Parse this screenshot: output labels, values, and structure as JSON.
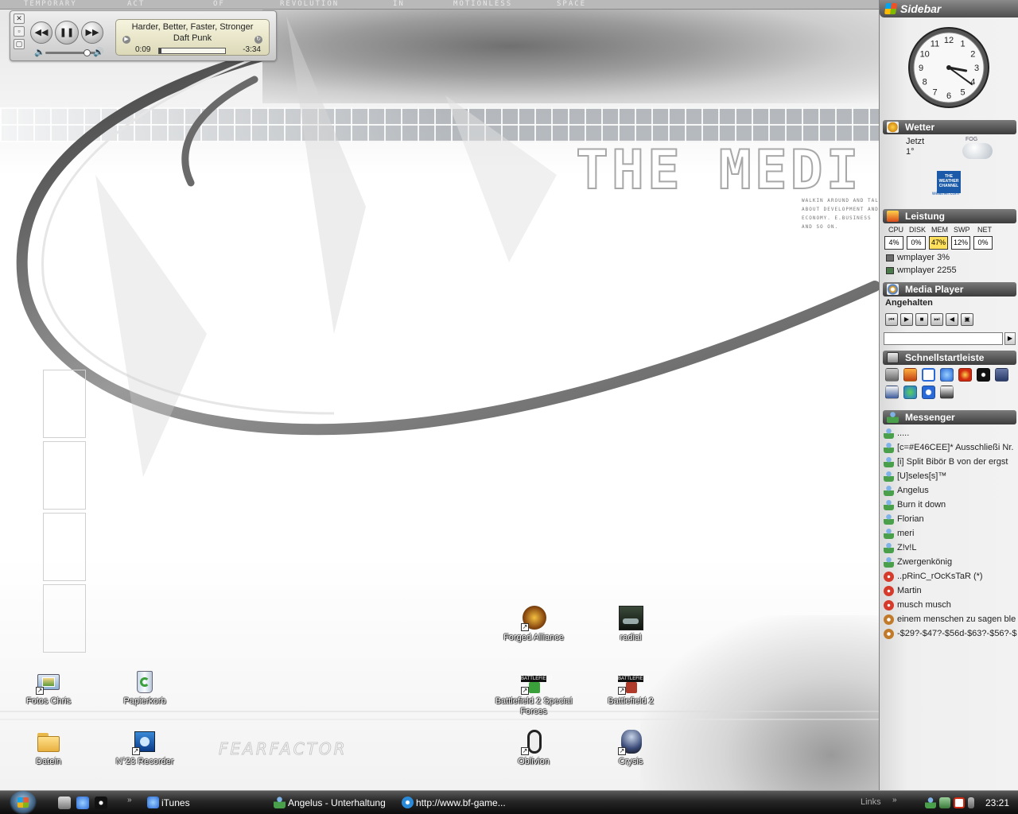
{
  "wallpaper": {
    "top_words": [
      "TEMPORARY",
      "ACT",
      "OF",
      "REVOLUTION",
      "IN",
      "MOTIONLESS",
      "SPACE"
    ],
    "title": "THE MEDI",
    "small_text": [
      "WALKIN AROUND AND TAL",
      "ABOUT DEVELOPMENT AND",
      "ECONOMY. E.BUSINESS",
      "AND SO ON."
    ],
    "fear_text": "FEARFACTOR"
  },
  "media_player": {
    "song": "Harder, Better, Faster, Stronger",
    "artist": "Daft Punk",
    "elapsed": "0:09",
    "remaining": "-3:34",
    "progress_fraction": 0.04,
    "volume_fraction": 0.75,
    "buttons": {
      "prev": "◀◀",
      "pause": "❚❚",
      "next": "▶▶"
    }
  },
  "desktop_icons": [
    {
      "id": "fotos",
      "label": "Fotos Chris"
    },
    {
      "id": "papierkorb",
      "label": "Papierkorb"
    },
    {
      "id": "dateien",
      "label": "Datein"
    },
    {
      "id": "recorder",
      "label": "N°23 Recorder"
    },
    {
      "id": "forged",
      "label": "Forged Alliance"
    },
    {
      "id": "radial",
      "label": "radial"
    },
    {
      "id": "bf2sf",
      "label": "Battlefield 2 Special Forces"
    },
    {
      "id": "bf2",
      "label": "Battlefield 2"
    },
    {
      "id": "oblivion",
      "label": "Oblivion"
    },
    {
      "id": "crysis",
      "label": "Crysis"
    }
  ],
  "sidebar": {
    "title": "Sidebar",
    "clock": {
      "numbers": [
        "12",
        "1",
        "2",
        "3",
        "4",
        "5",
        "6",
        "7",
        "8",
        "9",
        "10",
        "11"
      ],
      "hour": 3,
      "minute": 21
    },
    "weather": {
      "header": "Wetter",
      "label": "Jetzt",
      "temp": "1°",
      "condition": "FOG",
      "brand": "THE WEATHER CHANNEL",
      "brand_url": "weather.com"
    },
    "performance": {
      "header": "Leistung",
      "labels": [
        "CPU",
        "DISK",
        "MEM",
        "SWP",
        "NET"
      ],
      "values": [
        "4%",
        "0%",
        "47%",
        "12%",
        "0%"
      ],
      "rows": [
        "wmplayer 3%",
        "wmplayer 2255"
      ]
    },
    "media": {
      "header": "Media Player",
      "status": "Angehalten"
    },
    "quicklaunch": {
      "header": "Schnellstartleiste"
    },
    "messenger": {
      "header": "Messenger",
      "contacts": [
        {
          "name": ".....",
          "status": "online"
        },
        {
          "name": "[c=#E46CEE]* Ausschließi Nr.",
          "status": "online"
        },
        {
          "name": "[i] Split Bibör B von der ergst",
          "status": "online"
        },
        {
          "name": "[U]seles[s]™",
          "status": "online"
        },
        {
          "name": "Angelus",
          "status": "online"
        },
        {
          "name": "Burn it down",
          "status": "online"
        },
        {
          "name": "Florian",
          "status": "online"
        },
        {
          "name": "meri",
          "status": "online"
        },
        {
          "name": "Z!v!L",
          "status": "online"
        },
        {
          "name": "Zwergenkönig",
          "status": "online"
        },
        {
          "name": "..pRinC_rOcKsTaR (*)",
          "status": "busy"
        },
        {
          "name": "Martin",
          "status": "busy"
        },
        {
          "name": "musch musch",
          "status": "busy"
        },
        {
          "name": "einem menschen zu sagen ble",
          "status": "away"
        },
        {
          "name": "-$29?-$47?-$56d-$63?-$56?-$",
          "status": "away"
        }
      ]
    }
  },
  "taskbar": {
    "buttons": [
      {
        "label": "iTunes"
      },
      {
        "label": "Angelus - Unterhaltung"
      },
      {
        "label": "http://www.bf-game..."
      }
    ],
    "links": "Links",
    "clock": "23:21"
  }
}
